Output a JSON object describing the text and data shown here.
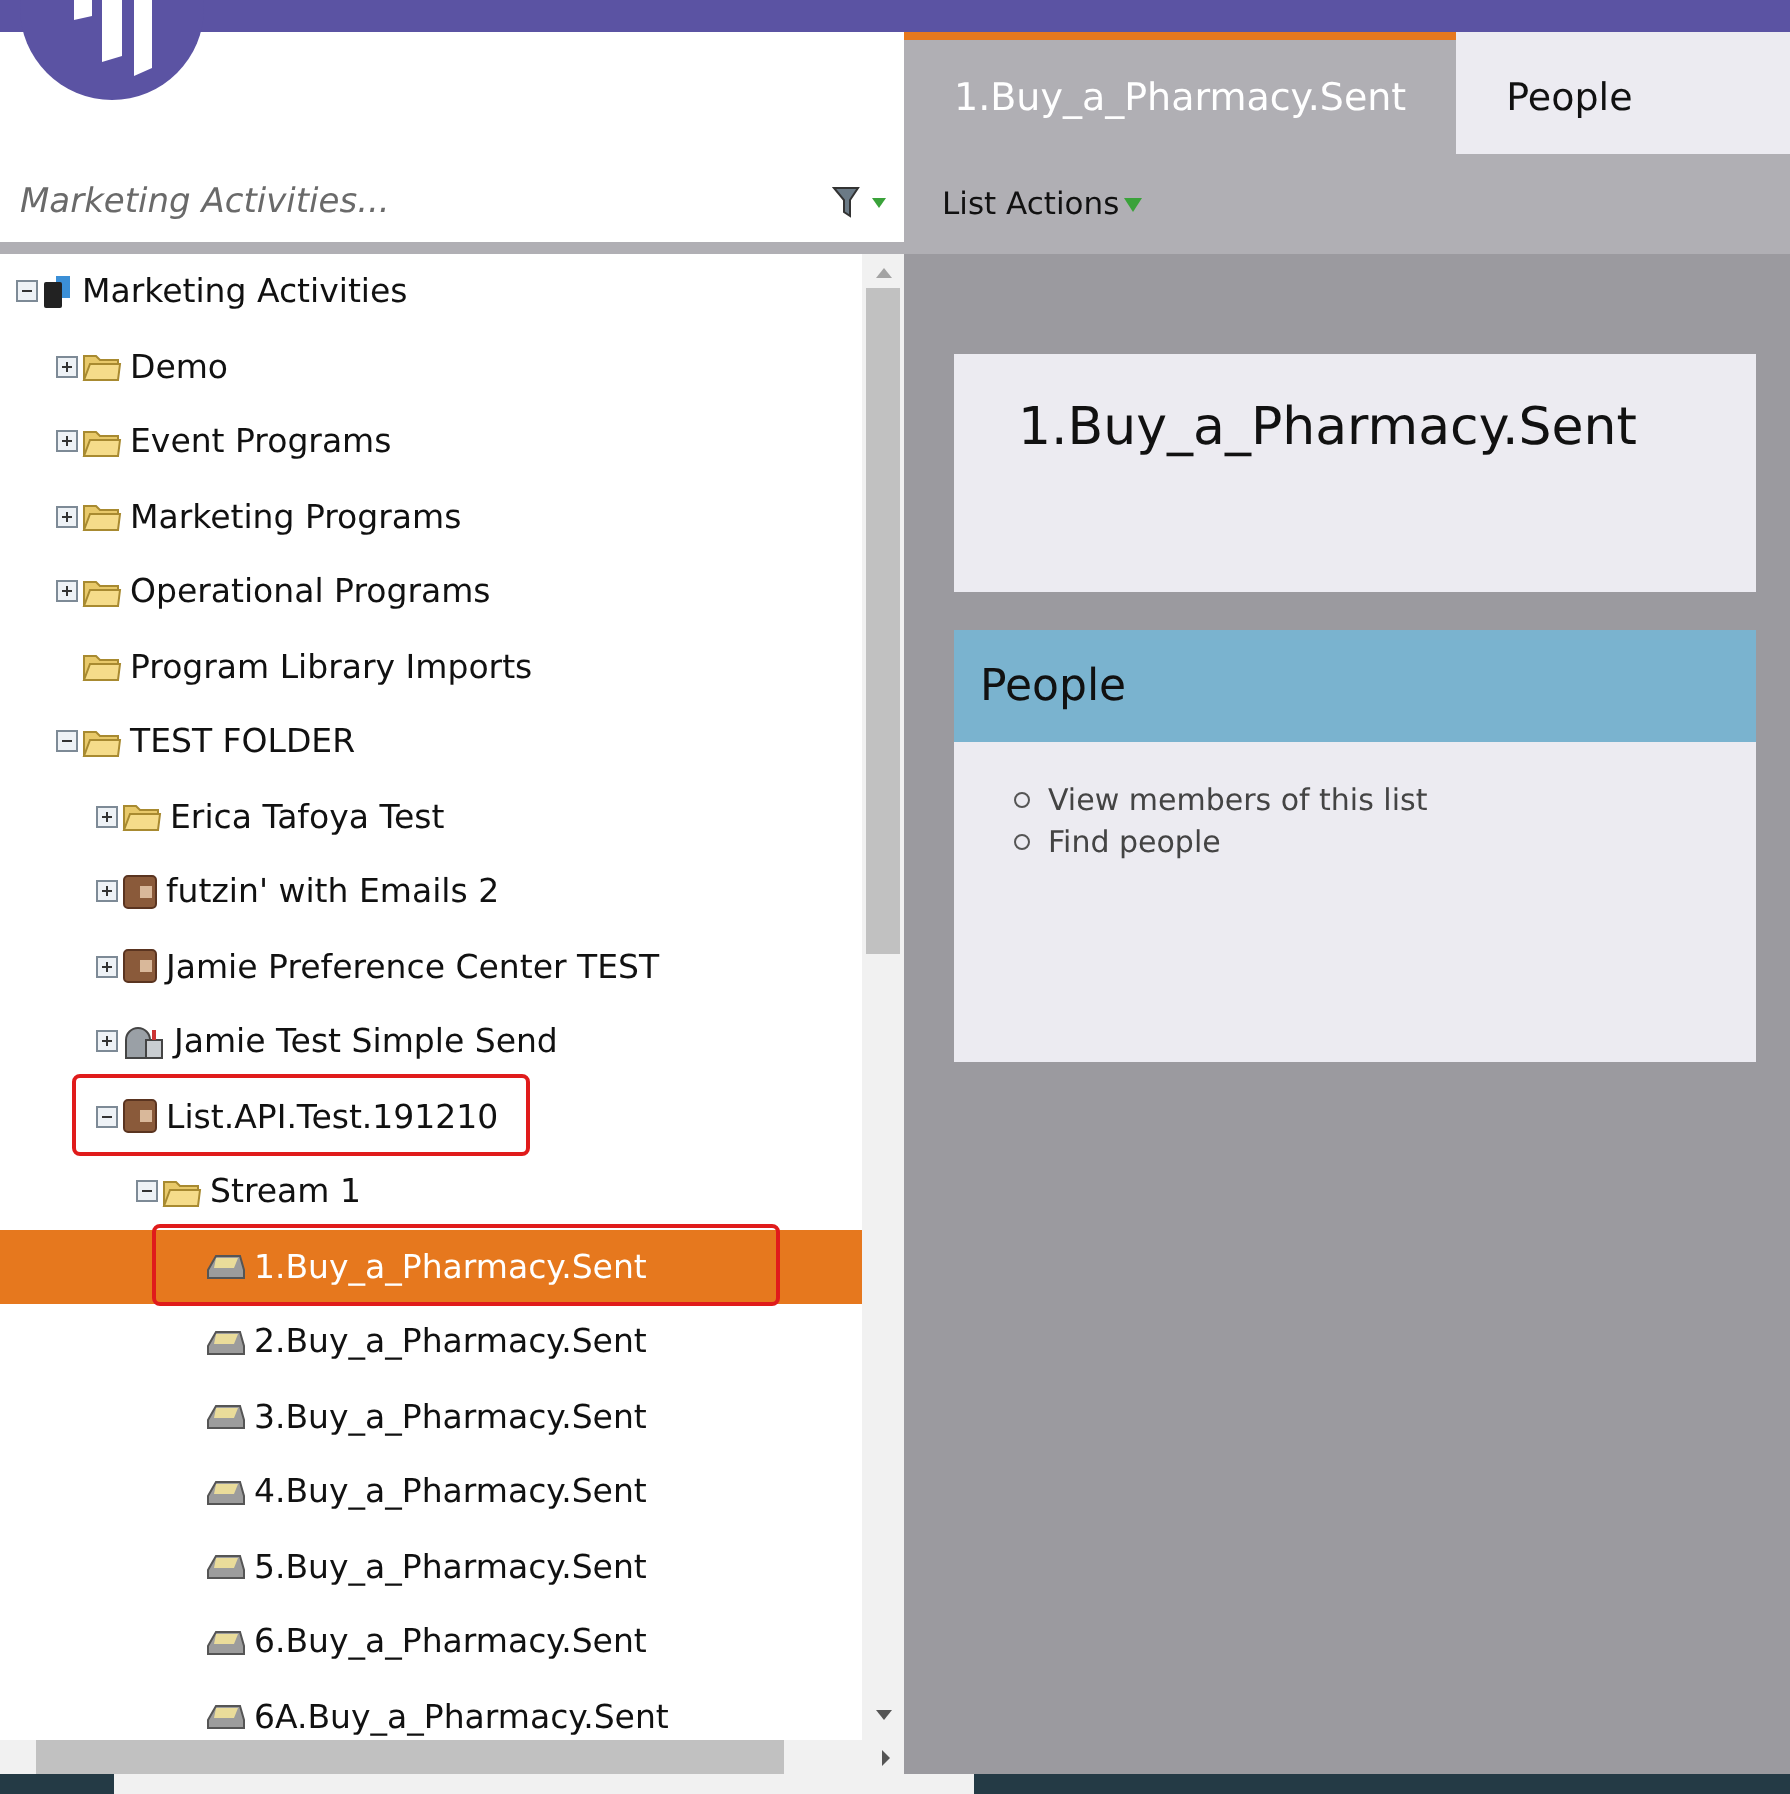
{
  "search": {
    "placeholder": "Marketing Activities..."
  },
  "tree": [
    {
      "label": "Marketing Activities",
      "kind": "root",
      "expanded": true,
      "selected": false,
      "circled": false,
      "children": [
        {
          "label": "Demo",
          "kind": "folder",
          "expanded": false,
          "selected": false,
          "circled": false
        },
        {
          "label": "Event Programs",
          "kind": "folder",
          "expanded": false,
          "selected": false,
          "circled": false
        },
        {
          "label": "Marketing Programs",
          "kind": "folder",
          "expanded": false,
          "selected": false,
          "circled": false
        },
        {
          "label": "Operational Programs",
          "kind": "folder",
          "expanded": false,
          "selected": false,
          "circled": false
        },
        {
          "label": "Program Library Imports",
          "kind": "folder",
          "selected": false,
          "circled": false
        },
        {
          "label": "TEST FOLDER",
          "kind": "folder",
          "expanded": true,
          "selected": false,
          "circled": false,
          "children": [
            {
              "label": "Erica Tafoya Test",
              "kind": "folder",
              "expanded": false,
              "selected": false,
              "circled": false
            },
            {
              "label": "futzin' with Emails 2",
              "kind": "program",
              "expanded": false,
              "selected": false,
              "circled": false
            },
            {
              "label": "Jamie Preference Center TEST",
              "kind": "program",
              "expanded": false,
              "selected": false,
              "circled": false
            },
            {
              "label": "Jamie Test Simple Send",
              "kind": "mailbox",
              "expanded": false,
              "selected": false,
              "circled": false
            },
            {
              "label": "List.API.Test.191210",
              "kind": "program",
              "expanded": true,
              "selected": false,
              "circled": true,
              "children": [
                {
                  "label": "Stream 1",
                  "kind": "folder",
                  "expanded": true,
                  "selected": false,
                  "circled": false,
                  "children": [
                    {
                      "label": "1.Buy_a_Pharmacy.Sent",
                      "kind": "list",
                      "selected": true,
                      "circled": true
                    },
                    {
                      "label": "2.Buy_a_Pharmacy.Sent",
                      "kind": "list",
                      "selected": false,
                      "circled": false
                    },
                    {
                      "label": "3.Buy_a_Pharmacy.Sent",
                      "kind": "list",
                      "selected": false,
                      "circled": false
                    },
                    {
                      "label": "4.Buy_a_Pharmacy.Sent",
                      "kind": "list",
                      "selected": false,
                      "circled": false
                    },
                    {
                      "label": "5.Buy_a_Pharmacy.Sent",
                      "kind": "list",
                      "selected": false,
                      "circled": false
                    },
                    {
                      "label": "6.Buy_a_Pharmacy.Sent",
                      "kind": "list",
                      "selected": false,
                      "circled": false
                    },
                    {
                      "label": "6A.Buy_a_Pharmacy.Sent",
                      "kind": "list",
                      "selected": false,
                      "circled": false
                    }
                  ]
                }
              ]
            }
          ]
        }
      ]
    }
  ],
  "tabs": [
    {
      "label": "1.Buy_a_Pharmacy.Sent",
      "selected": true
    },
    {
      "label": "People",
      "selected": false
    }
  ],
  "toolbar": {
    "menu": "List Actions"
  },
  "header_card": {
    "title": "1.Buy_a_Pharmacy.Sent"
  },
  "people_panel": {
    "title": "People",
    "links": [
      "View members of this list",
      "Find people"
    ]
  }
}
